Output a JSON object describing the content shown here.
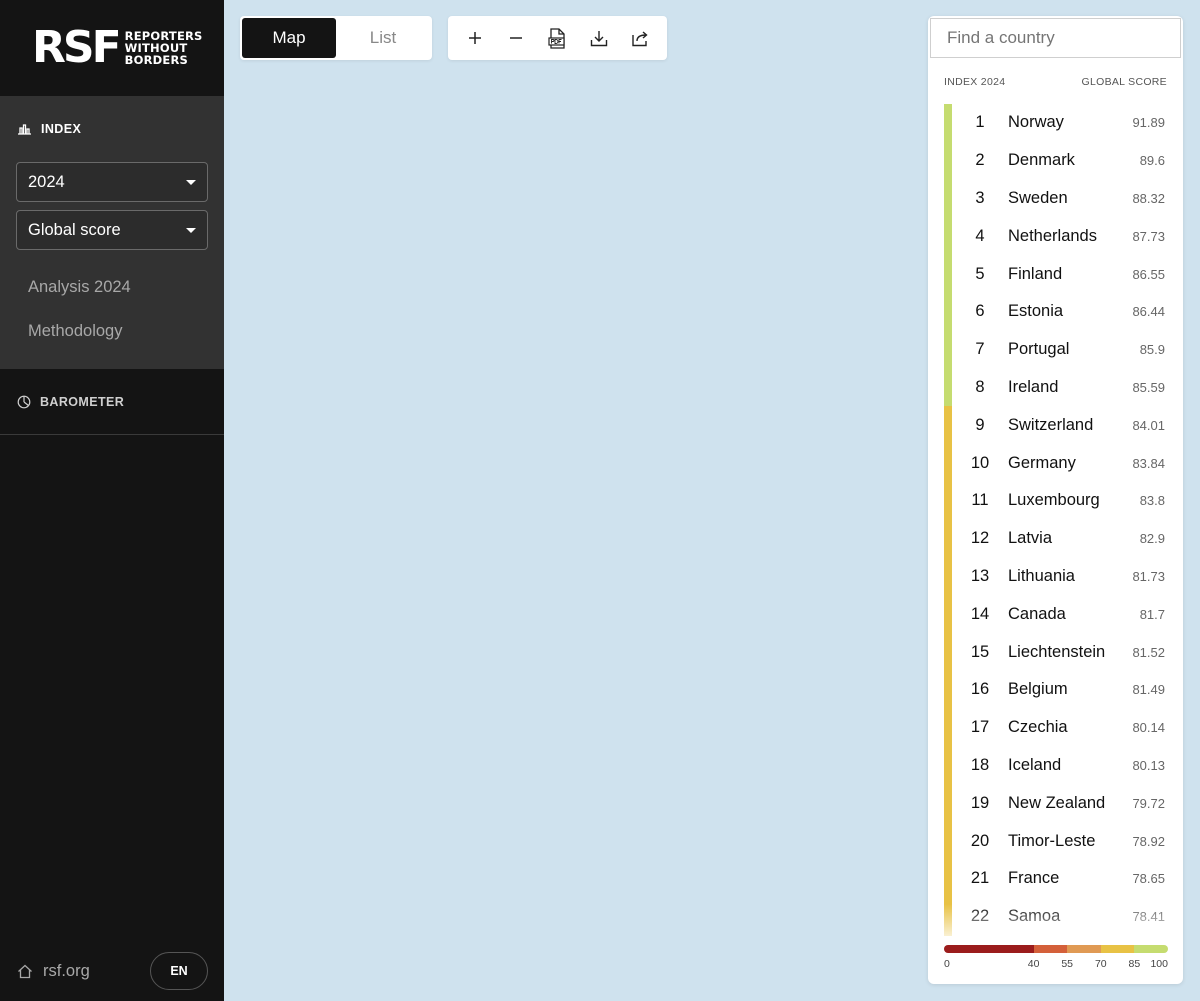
{
  "brand": {
    "mark": "RSF",
    "line1": "REPORTERS",
    "line2": "WITHOUT BORDERS"
  },
  "sidebar": {
    "index_label": "INDEX",
    "year_select": "2024",
    "metric_select": "Global score",
    "links": [
      "Analysis 2024",
      "Methodology"
    ],
    "barometer_label": "BAROMETER",
    "site_link": "rsf.org",
    "language": "EN"
  },
  "toolbar": {
    "views": [
      "Map",
      "List"
    ],
    "active_view": "Map",
    "tools": [
      {
        "name": "zoom-in",
        "icon": "plus-icon"
      },
      {
        "name": "zoom-out",
        "icon": "minus-icon"
      },
      {
        "name": "pdf",
        "icon": "pdf-icon"
      },
      {
        "name": "download",
        "icon": "download-icon"
      },
      {
        "name": "share",
        "icon": "share-icon"
      }
    ]
  },
  "ranking": {
    "search_placeholder": "Find a country",
    "header_left": "INDEX 2024",
    "header_right": "GLOBAL SCORE",
    "rows": [
      {
        "rank": "1",
        "country": "Norway",
        "score": "91.89"
      },
      {
        "rank": "2",
        "country": "Denmark",
        "score": "89.6"
      },
      {
        "rank": "3",
        "country": "Sweden",
        "score": "88.32"
      },
      {
        "rank": "4",
        "country": "Netherlands",
        "score": "87.73"
      },
      {
        "rank": "5",
        "country": "Finland",
        "score": "86.55"
      },
      {
        "rank": "6",
        "country": "Estonia",
        "score": "86.44"
      },
      {
        "rank": "7",
        "country": "Portugal",
        "score": "85.9"
      },
      {
        "rank": "8",
        "country": "Ireland",
        "score": "85.59"
      },
      {
        "rank": "9",
        "country": "Switzerland",
        "score": "84.01"
      },
      {
        "rank": "10",
        "country": "Germany",
        "score": "83.84"
      },
      {
        "rank": "11",
        "country": "Luxembourg",
        "score": "83.8"
      },
      {
        "rank": "12",
        "country": "Latvia",
        "score": "82.9"
      },
      {
        "rank": "13",
        "country": "Lithuania",
        "score": "81.73"
      },
      {
        "rank": "14",
        "country": "Canada",
        "score": "81.7"
      },
      {
        "rank": "15",
        "country": "Liechtenstein",
        "score": "81.52"
      },
      {
        "rank": "16",
        "country": "Belgium",
        "score": "81.49"
      },
      {
        "rank": "17",
        "country": "Czechia",
        "score": "80.14"
      },
      {
        "rank": "18",
        "country": "Iceland",
        "score": "80.13"
      },
      {
        "rank": "19",
        "country": "New Zealand",
        "score": "79.72"
      },
      {
        "rank": "20",
        "country": "Timor-Leste",
        "score": "78.92"
      },
      {
        "rank": "21",
        "country": "France",
        "score": "78.65"
      },
      {
        "rank": "22",
        "country": "Samoa",
        "score": "78.41"
      }
    ],
    "legend": {
      "ticks": [
        "0",
        "40",
        "55",
        "70",
        "85",
        "100"
      ],
      "tick_values": [
        0,
        40,
        55,
        70,
        85,
        100
      ],
      "colors": [
        "#9b1c1c",
        "#d4603a",
        "#e09a54",
        "#e8c245",
        "#c5dc70"
      ]
    }
  }
}
